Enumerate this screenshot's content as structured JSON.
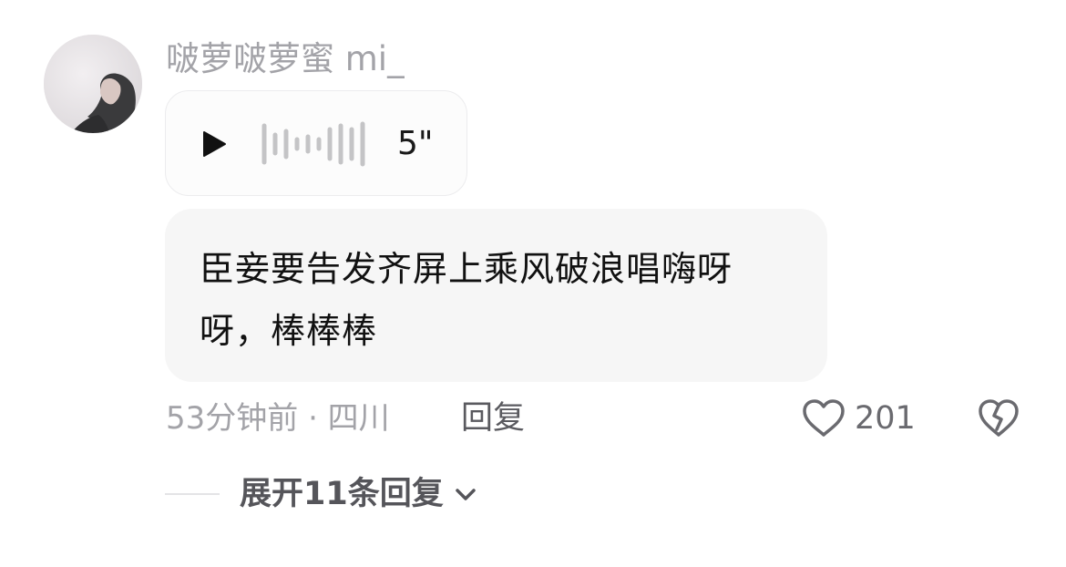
{
  "comment": {
    "username": "啵萝啵萝蜜 mi_",
    "voice": {
      "duration": "5\""
    },
    "text": "臣妾要告发齐屏上乘风破浪唱嗨呀呀，棒棒棒",
    "time_location": "53分钟前 · 四川",
    "reply_label": "回复",
    "like_count": "201"
  },
  "thread": {
    "expand_label": "展开11条回复"
  },
  "icons": {
    "play": "play-icon",
    "waveform": "audio-waveform-icon",
    "like": "heart-outline-icon",
    "dislike": "broken-heart-icon",
    "expand": "chevron-down-icon"
  },
  "colors": {
    "username": "#a3a3a8",
    "bubble_bg": "#f6f6f6",
    "text": "#111111",
    "meta": "#a3a3a8",
    "reply": "#5a5a5f"
  }
}
